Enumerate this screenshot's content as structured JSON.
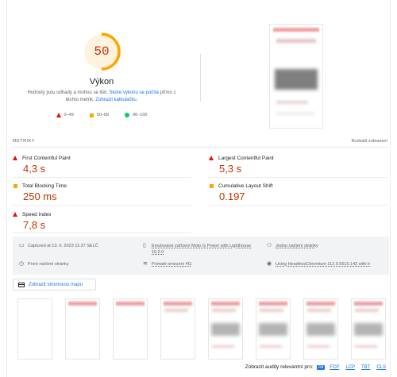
{
  "performance": {
    "score": "50",
    "score_fraction": 0.5,
    "title": "Výkon",
    "desc_text": "Hodnoty jsou odhady a mohou se lišit. ",
    "desc_link1": "Skóre výkonu se počítá",
    "desc_mid": " přímo z těchto metrik. ",
    "desc_link2": "Zobrazit kalkulačku.",
    "colors": {
      "fail": "#eb0f00",
      "average": "#ffa400",
      "pass": "#0cce6b",
      "gauge_arc": "#ffa400"
    }
  },
  "legend": [
    {
      "label": "0–49",
      "shape": "triangle"
    },
    {
      "label": "50–89",
      "shape": "square"
    },
    {
      "label": "90–100",
      "shape": "circle"
    }
  ],
  "metrics_section": {
    "label": "METRIKY",
    "toggle": "Rozbalit zobrazení",
    "items": [
      {
        "name": "First Contentful Paint",
        "value": "4,3 s",
        "status": "fail"
      },
      {
        "name": "Largest Contentful Paint",
        "value": "5,3 s",
        "status": "fail"
      },
      {
        "name": "Total Blocking Time",
        "value": "250 ms",
        "status": "average"
      },
      {
        "name": "Cumulative Layout Shift",
        "value": "0.197",
        "status": "average"
      },
      {
        "name": "Speed Index",
        "value": "7,8 s",
        "status": "fail"
      }
    ]
  },
  "runtime": {
    "captured": "Captured at 13. 6. 2023 11:37 SELČ",
    "device_line1": "Emulované zařízení Moto G Power with Lighthouse",
    "device_line2": "10.2.0",
    "single_load": "Jedno načtení stránky",
    "initial_load": "První načtení stránky",
    "throttling": "Pomalé omezení 4G",
    "browser": "Using HeadlessChromium 112.0.5615.142 with lr"
  },
  "treemap_button": "Zobrazit stromovou mapu",
  "audits_filter": {
    "label": "Zobrazit audity relevantní pro:",
    "chips": [
      "All",
      "FCP",
      "LCP",
      "TBT",
      "CLS"
    ],
    "active": "All"
  }
}
